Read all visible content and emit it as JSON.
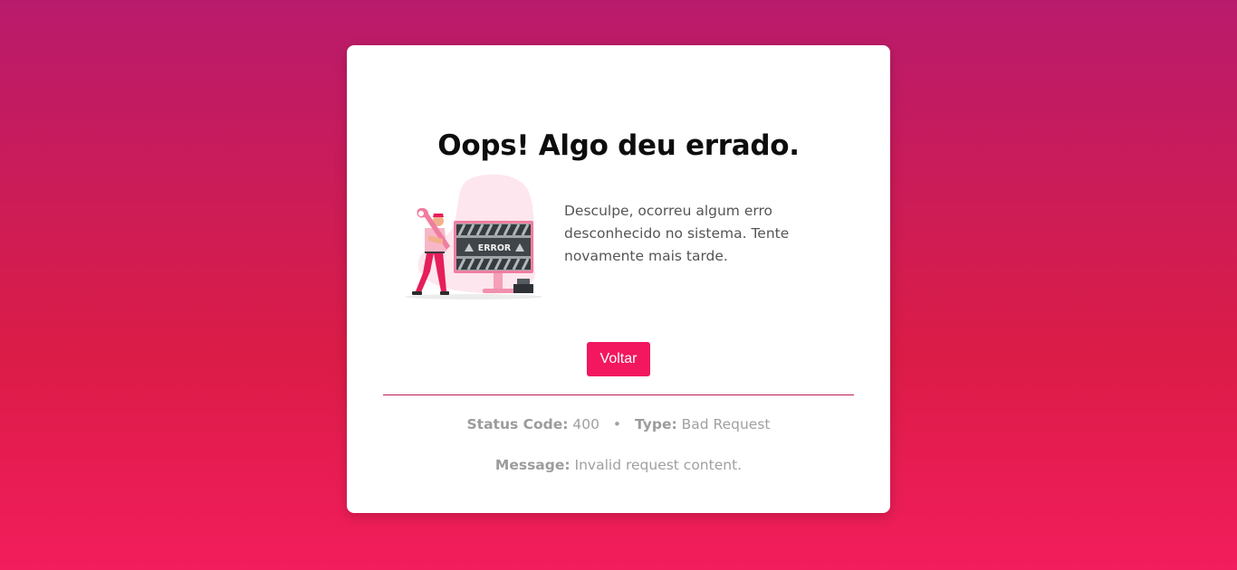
{
  "card": {
    "title": "Oops! Algo deu errado.",
    "description": "Desculpe, ocorreu algum erro desconhecido no sistema. Tente novamente mais tarde.",
    "illustration": {
      "screen_text": "ERROR",
      "icon": "error-maintenance-illustration"
    },
    "back_button": "Voltar",
    "details": {
      "status_label": "Status Code:",
      "status_value": "400",
      "separator": "•",
      "type_label": "Type:",
      "type_value": "Bad Request",
      "message_label": "Message:",
      "message_value": "Invalid request content."
    }
  },
  "colors": {
    "gradient_top": "#b91b6c",
    "gradient_bottom": "#f21d5c",
    "accent": "#f2175f"
  }
}
